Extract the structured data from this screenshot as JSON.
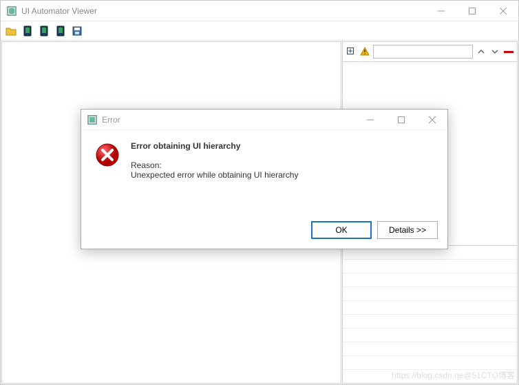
{
  "window": {
    "title": "UI Automator Viewer"
  },
  "toolbar": {
    "icons": [
      "open",
      "screenshot-device-1",
      "screenshot-device-2",
      "screenshot-device-3",
      "save"
    ]
  },
  "rightPanel": {
    "search_value": ""
  },
  "dialog": {
    "title": "Error",
    "heading": "Error obtaining UI hierarchy",
    "reason_label": "Reason:",
    "reason_text": "Unexpected error while obtaining UI hierarchy",
    "ok_label": "OK",
    "details_label": "Details >>"
  },
  "watermark": "https://blog.csdn.ne@51CTO博客"
}
